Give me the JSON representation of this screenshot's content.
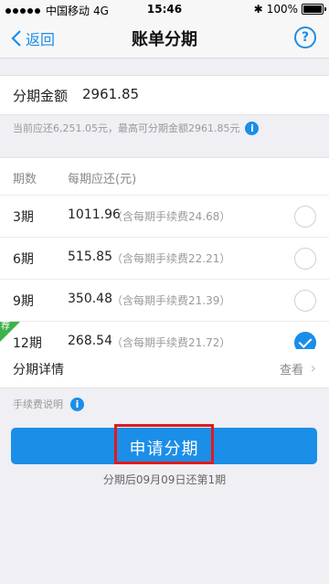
{
  "status_bar": {
    "carrier": "中国移动",
    "network": "4G",
    "time": "15:46",
    "battery": "100%"
  },
  "nav": {
    "back_label": "返回",
    "title": "账单分期",
    "help_label": "?"
  },
  "amount": {
    "label": "分期金额",
    "value": "2961.85"
  },
  "hint": {
    "text": "当前应还6,251.05元，最高可分期金额2961.85元",
    "icon": "info-icon"
  },
  "periods": {
    "header_term": "期数",
    "header_payment": "每期应还(元)",
    "rows": [
      {
        "term": "3期",
        "amount": "1011.96",
        "fee": "（含每期手续费24.68）",
        "selected": false
      },
      {
        "term": "6期",
        "amount": "515.85",
        "fee": "（含每期手续费22.21）",
        "selected": false
      },
      {
        "term": "9期",
        "amount": "350.48",
        "fee": "（含每期手续费21.39）",
        "selected": false
      },
      {
        "term": "12期",
        "amount": "268.54",
        "fee": "（含每期手续费21.72）",
        "selected": true,
        "badge": "荐"
      }
    ]
  },
  "detail": {
    "label": "分期详情",
    "view_label": "查看"
  },
  "fee_note": {
    "label": "手续费说明"
  },
  "apply": {
    "label": "申请分期"
  },
  "repay_note": "分期后09月09日还第1期",
  "colors": {
    "accent": "#1b8ee8",
    "recommend": "#3fb14a",
    "highlight": "#e01b1b"
  }
}
